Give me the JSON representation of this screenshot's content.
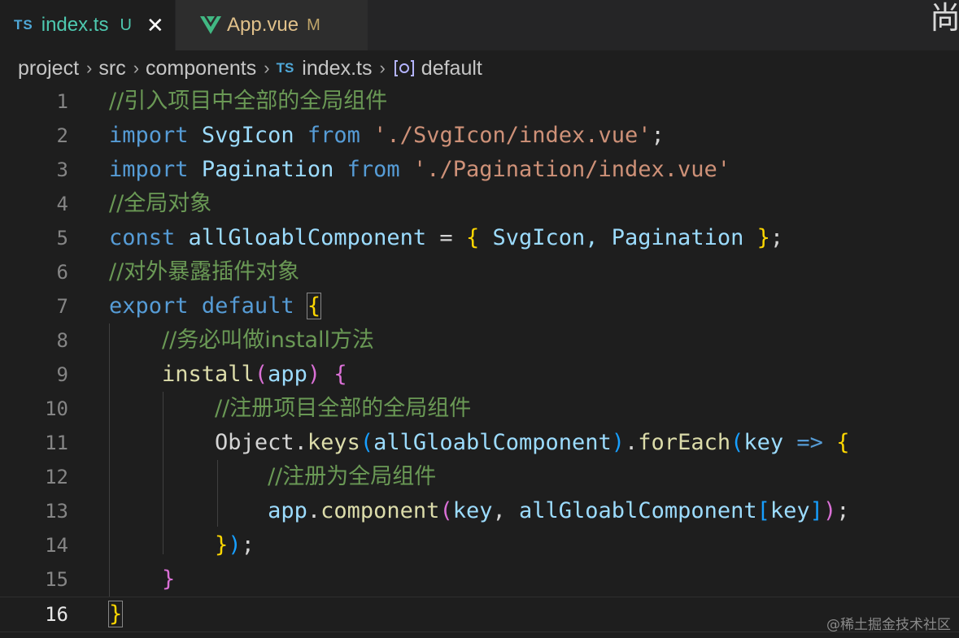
{
  "tabs": [
    {
      "badge": "TS",
      "name": "index.ts",
      "status": "U",
      "close": "✕"
    },
    {
      "name": "App.vue",
      "status": "M"
    }
  ],
  "corner_glyph": "尚",
  "breadcrumb": {
    "parts": [
      "project",
      "src",
      "components"
    ],
    "file_badge": "TS",
    "file": "index.ts",
    "symbol": "default"
  },
  "editor": {
    "line_numbers": [
      "1",
      "2",
      "3",
      "4",
      "5",
      "6",
      "7",
      "8",
      "9",
      "10",
      "11",
      "12",
      "13",
      "14",
      "15",
      "16"
    ],
    "lines": {
      "l1": {
        "comment": "//引入项目中全部的全局组件"
      },
      "l2": {
        "kw1": "import",
        "name": "SvgIcon",
        "kw2": "from",
        "str": "'./SvgIcon/index.vue'",
        "end": ";"
      },
      "l3": {
        "kw1": "import",
        "name": "Pagination",
        "kw2": "from",
        "str": "'./Pagination/index.vue'"
      },
      "l4": {
        "comment": "//全局对象"
      },
      "l5": {
        "kw": "const",
        "name": "allGloablComponent",
        "eq": "=",
        "open": "{",
        "items": "SvgIcon, Pagination",
        "close": "}",
        "end": ";"
      },
      "l6": {
        "comment": "//对外暴露插件对象"
      },
      "l7": {
        "kw1": "export",
        "kw2": "default",
        "open": "{"
      },
      "l8": {
        "comment": "//务必叫做install方法"
      },
      "l9": {
        "fn": "install",
        "open": "(",
        "param": "app",
        "close": ")",
        "brace": "{"
      },
      "l10": {
        "comment": "//注册项目全部的全局组件"
      },
      "l11": {
        "obj": "Object",
        "dot1": ".",
        "fn1": "keys",
        "p_open": "(",
        "arg": "allGloablComponent",
        "p_close": ")",
        "dot2": ".",
        "fn2": "forEach",
        "p2_open": "(",
        "param": "key",
        "arrow": "=>",
        "brace": "{"
      },
      "l12": {
        "comment": "//注册为全局组件"
      },
      "l13": {
        "obj": "app",
        "dot": ".",
        "fn": "component",
        "p_open": "(",
        "arg1": "key",
        "comma": ",",
        "arg2": "allGloablComponent",
        "b_open": "[",
        "arg3": "key",
        "b_close": "]",
        "p_close": ")",
        "end": ";"
      },
      "l14": {
        "brace": "}",
        "paren": ")",
        "end": ";"
      },
      "l15": {
        "brace": "}"
      },
      "l16": {
        "brace": "}"
      }
    }
  },
  "watermark": "@稀土掘金技术社区",
  "colors": {
    "background": "#1e1e1e",
    "keyword": "#569cd6",
    "string": "#ce9178",
    "comment": "#6a9955",
    "function": "#dcdcaa",
    "variable": "#9cdcfe",
    "bracket_level1": "#ffd700",
    "bracket_level2": "#da70d6",
    "bracket_level3": "#179fff"
  }
}
